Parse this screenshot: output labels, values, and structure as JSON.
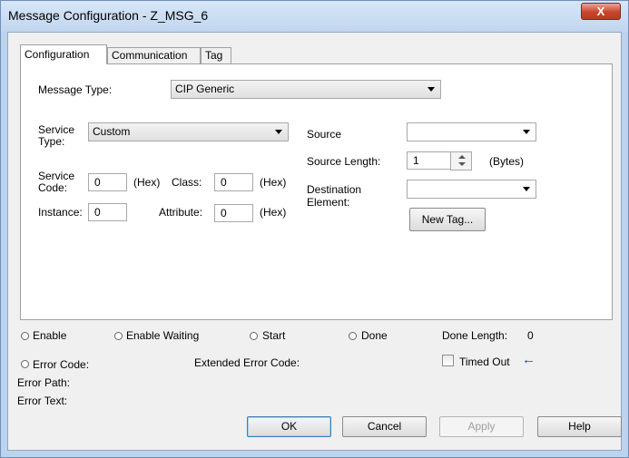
{
  "window": {
    "title": "Message Configuration - Z_MSG_6",
    "close_glyph": "X"
  },
  "tabs": [
    {
      "label": "Configuration",
      "active": true
    },
    {
      "label": "Communication",
      "active": false
    },
    {
      "label": "Tag",
      "active": false
    }
  ],
  "config": {
    "message_type_label": "Message Type:",
    "message_type_value": "CIP Generic",
    "service_type_label_1": "Service",
    "service_type_label_2": "Type:",
    "service_type_value": "Custom",
    "service_code_label_1": "Service",
    "service_code_label_2": "Code:",
    "service_code_value": "0",
    "service_code_unit": "(Hex)",
    "class_label": "Class:",
    "class_value": "0",
    "class_unit": "(Hex)",
    "instance_label": "Instance:",
    "instance_value": "0",
    "attribute_label": "Attribute:",
    "attribute_value": "0",
    "attribute_unit": "(Hex)",
    "source_label": "Source",
    "source_value": "",
    "source_length_label": "Source Length:",
    "source_length_value": "1",
    "source_length_unit": "(Bytes)",
    "destination_label_1": "Destination",
    "destination_label_2": "Element:",
    "destination_value": "",
    "new_tag_button": "New Tag..."
  },
  "status": {
    "enable": "Enable",
    "enable_waiting": "Enable Waiting",
    "start": "Start",
    "done": "Done",
    "done_length_label": "Done Length:",
    "done_length_value": "0",
    "error_code": "Error Code:",
    "extended_error_code": "Extended Error Code:",
    "timed_out": "Timed Out",
    "timed_out_arrow": "←",
    "error_path": "Error Path:",
    "error_text": "Error Text:"
  },
  "buttons": {
    "ok": "OK",
    "cancel": "Cancel",
    "apply": "Apply",
    "help": "Help"
  },
  "colors": {
    "arrow_indicator": "#1a3fd1",
    "window_frame": "#bcd3ee"
  }
}
